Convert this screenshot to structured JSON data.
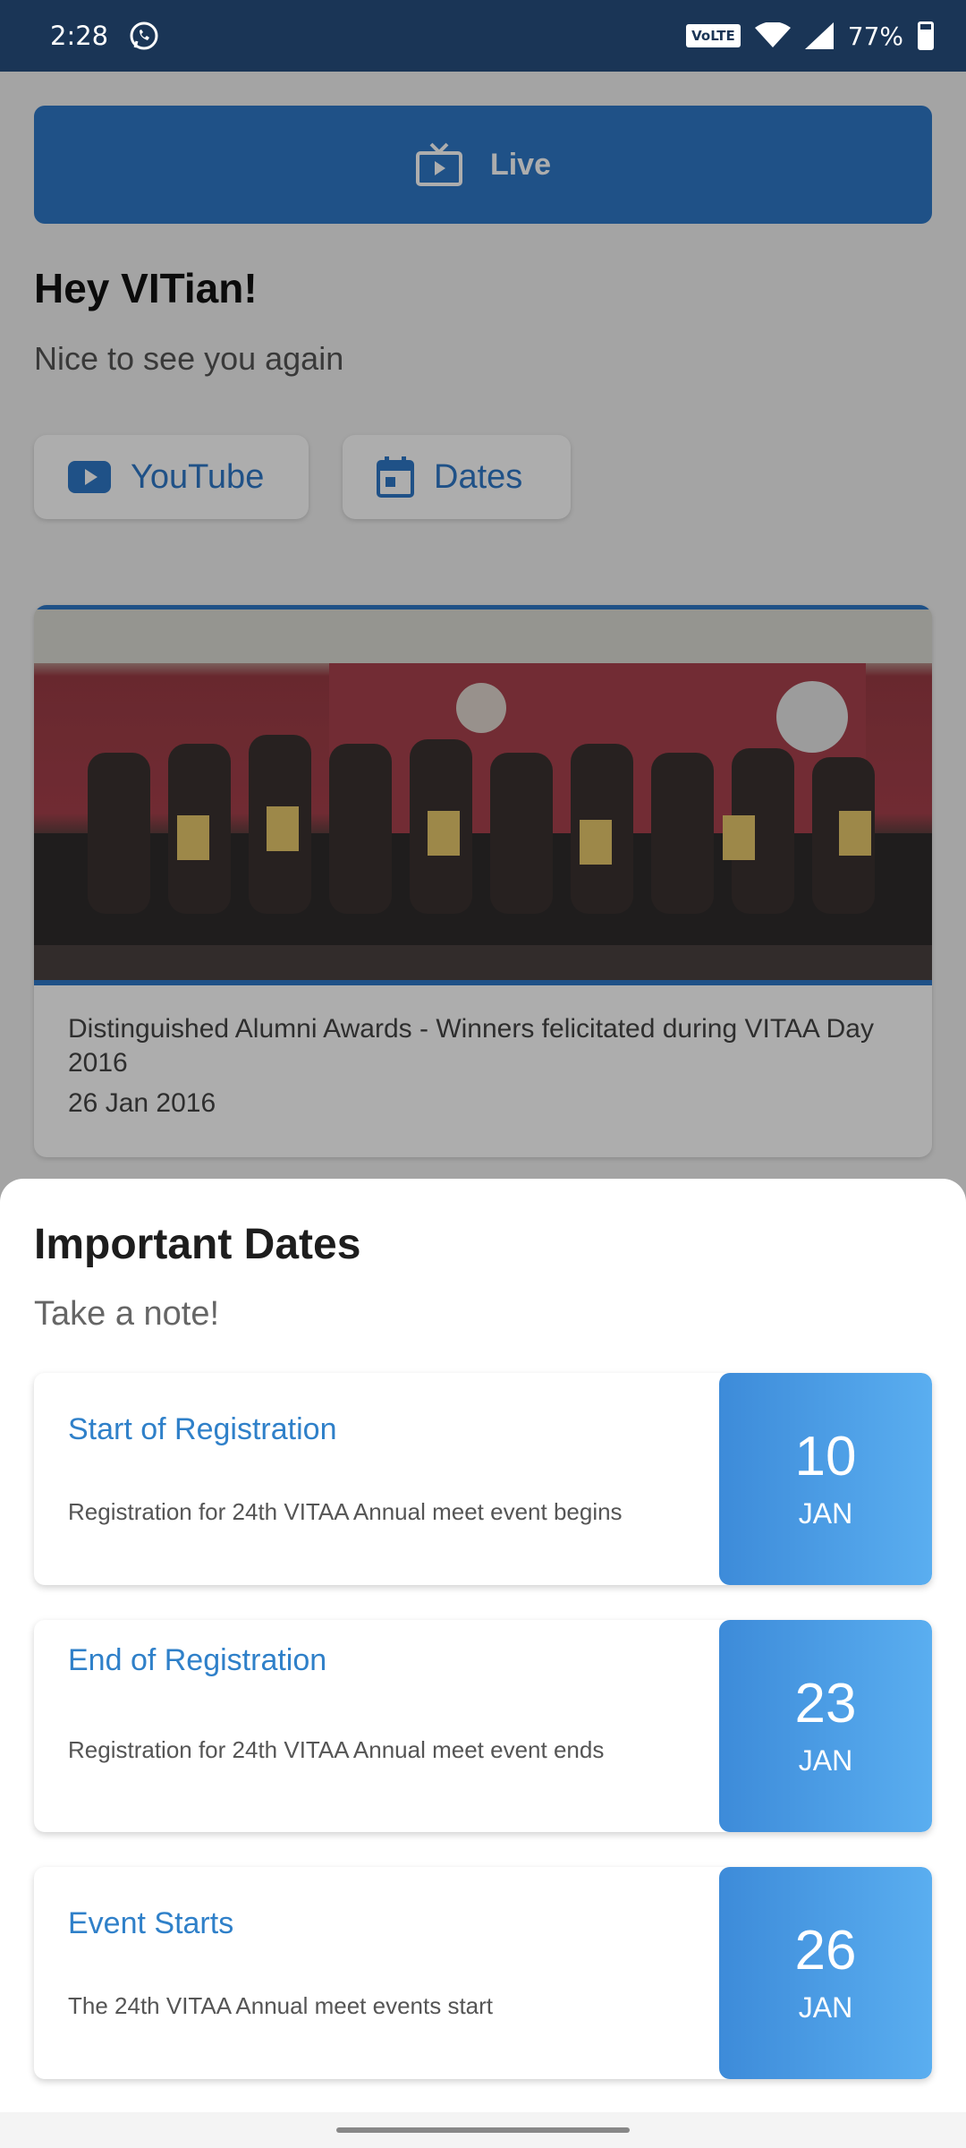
{
  "status_bar": {
    "time": "2:28",
    "network_badge": "VoLTE",
    "battery": "77%"
  },
  "home": {
    "live_label": "Live",
    "greeting": "Hey VITian!",
    "sub_greeting": "Nice to see you again",
    "chips": [
      {
        "label": "YouTube",
        "icon": "youtube-icon"
      },
      {
        "label": "Dates",
        "icon": "calendar-icon"
      }
    ],
    "news": {
      "caption": "Distinguished Alumni Awards - Winners felicitated during VITAA Day 2016",
      "date": "26 Jan 2016"
    }
  },
  "sheet": {
    "title": "Important Dates",
    "subtitle": "Take a note!",
    "items": [
      {
        "title": "Start of Registration",
        "description": "Registration for 24th VITAA Annual meet event begins",
        "day": "10",
        "month": "JAN"
      },
      {
        "title": "End of Registration",
        "description": "Registration for 24th VITAA Annual meet event ends",
        "day": "23",
        "month": "JAN"
      },
      {
        "title": "Event Starts",
        "description": "The 24th VITAA Annual meet events start",
        "day": "26",
        "month": "JAN"
      }
    ]
  },
  "colors": {
    "primary": "#2f78c8",
    "status_bar": "#1a3556",
    "date_badge_start": "#3d8bd9",
    "date_badge_end": "#5aaef0"
  }
}
